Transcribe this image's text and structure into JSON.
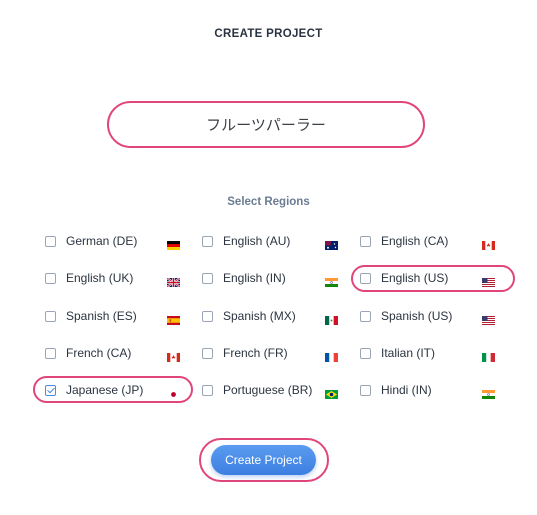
{
  "header": {
    "title": "CREATE PROJECT"
  },
  "project_name": {
    "value": "フルーツパーラー"
  },
  "regions": {
    "heading": "Select Regions",
    "rows": [
      [
        {
          "label": "German (DE)",
          "flag": "de-flag",
          "checked": false
        },
        {
          "label": "English (AU)",
          "flag": "au-flag",
          "checked": false
        },
        {
          "label": "English (CA)",
          "flag": "ca-flag",
          "checked": false
        }
      ],
      [
        {
          "label": "English (UK)",
          "flag": "uk-flag",
          "checked": false
        },
        {
          "label": "English (IN)",
          "flag": "in-flag",
          "checked": false
        },
        {
          "label": "English (US)",
          "flag": "us-flag",
          "checked": false
        }
      ],
      [
        {
          "label": "Spanish (ES)",
          "flag": "es-flag",
          "checked": false
        },
        {
          "label": "Spanish (MX)",
          "flag": "mx-flag",
          "checked": false
        },
        {
          "label": "Spanish (US)",
          "flag": "us-flag",
          "checked": false
        }
      ],
      [
        {
          "label": "French (CA)",
          "flag": "ca-flag",
          "checked": false
        },
        {
          "label": "French (FR)",
          "flag": "fr-flag",
          "checked": false
        },
        {
          "label": "Italian (IT)",
          "flag": "it-flag",
          "checked": false
        }
      ],
      [
        {
          "label": "Japanese (JP)",
          "flag": "jp-flag",
          "checked": true
        },
        {
          "label": "Portuguese (BR)",
          "flag": "br-flag",
          "checked": false
        },
        {
          "label": "Hindi (IN)",
          "flag": "in-flag",
          "checked": false
        }
      ]
    ]
  },
  "actions": {
    "create_label": "Create Project"
  },
  "colors": {
    "highlight": "#e0457b",
    "accent": "#4a8ae8"
  }
}
